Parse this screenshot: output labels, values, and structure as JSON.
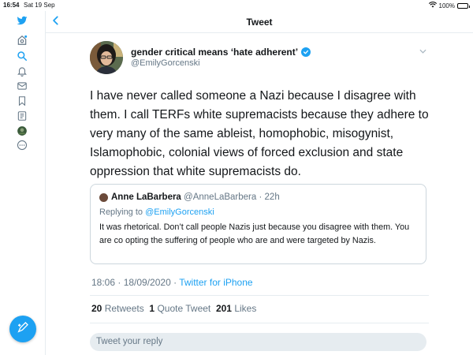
{
  "status": {
    "time": "16:54",
    "date": "Sat 19 Sep",
    "battery": "100%",
    "battery_level": 1.0
  },
  "header": {
    "title": "Tweet"
  },
  "sidebar": {
    "icons": [
      "twitter-logo-icon",
      "home-icon",
      "search-icon",
      "notifications-icon",
      "messages-icon",
      "bookmarks-icon",
      "lists-icon",
      "profile-icon",
      "more-icon"
    ],
    "compose_icon": "compose-icon"
  },
  "tweet": {
    "author_name": "gender critical means ‘hate adherent’",
    "author_handle": "@EmilyGorcenski",
    "text": "I have never called someone a Nazi because I disagree with them. I call TERFs white supremacists because they adhere to very many of the same ableist, homophobic, misogynist, Islamophobic, colonial views of forced exclusion and state oppression that white supremacists do.",
    "timestamp": "18:06 · 18/09/2020 · ",
    "source": "Twitter for iPhone"
  },
  "quote": {
    "author_name": "Anne LaBarbera",
    "author_handle": "@AnneLaBarbera",
    "time": "22h",
    "replying_prefix": "Replying to ",
    "replying_to": "@EmilyGorcenski",
    "text": "It was rhetorical. Don’t call people Nazis just because you disagree with them. You are co opting the suffering of people who are and were targeted by Nazis."
  },
  "stats": {
    "retweets_count": "20",
    "retweets_label": "Retweets",
    "quote_count": "1",
    "quote_label": "Quote Tweet",
    "likes_count": "201",
    "likes_label": "Likes"
  },
  "reply": {
    "placeholder": "Tweet your reply"
  },
  "colors": {
    "accent": "#1da1f2",
    "text": "#14171a",
    "secondary": "#657786",
    "border": "#e6ecf0"
  }
}
